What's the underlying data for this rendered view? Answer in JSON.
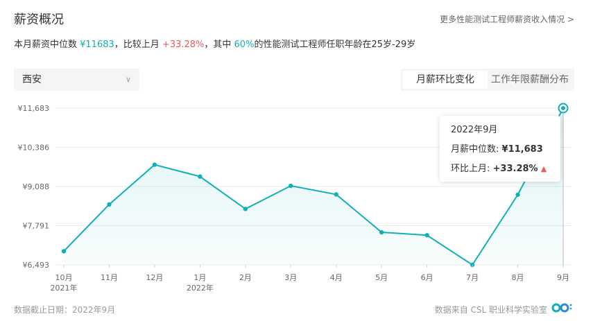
{
  "header": {
    "title": "薪资概况",
    "more_link": "更多性能测试工程师薪资收入情况 >"
  },
  "summary": {
    "prefix": "本月薪资中位数 ",
    "median": "¥11683",
    "mid1": "，比较上月 ",
    "change": "+33.28%",
    "mid2": "，其中 ",
    "percent": "60%",
    "suffix": "的性能测试工程师任职年龄在25岁-29岁"
  },
  "controls": {
    "city": "西安",
    "tabs": [
      "月薪环比变化",
      "工作年限薪酬分布"
    ],
    "active_tab": 0
  },
  "tooltip": {
    "month": "2022年9月",
    "median_label": "月薪中位数:",
    "median_value": "¥11,683",
    "change_label": "环比上月:",
    "change_value": "+33.28%",
    "change_icon": "up-triangle-icon"
  },
  "footer": {
    "date_note": "数据截止日期：2022年9月",
    "source": "数据来自 CSL 职业科学实验室",
    "logo_icon": "csl-logo-icon"
  },
  "colors": {
    "accent": "#11b0b6",
    "negative": "#e95a5a"
  },
  "chart_data": {
    "type": "area",
    "categories": [
      "10月",
      "11月",
      "12月",
      "1月",
      "2月",
      "3月",
      "4月",
      "5月",
      "6月",
      "7月",
      "8月",
      "9月"
    ],
    "year_labels": [
      "2021年",
      "",
      "",
      "2022年",
      "",
      "",
      "",
      "",
      "",
      "",
      "",
      ""
    ],
    "values": [
      6945,
      8495,
      9810,
      9418,
      8346,
      9110,
      8825,
      7571,
      7474,
      6493,
      8815,
      11683
    ],
    "y_ticks": [
      "¥6,493",
      "¥7,791",
      "¥9,088",
      "¥10,386",
      "¥11,683"
    ],
    "ylim": [
      6493,
      11683
    ],
    "highlight_index": 11,
    "grid": true
  }
}
